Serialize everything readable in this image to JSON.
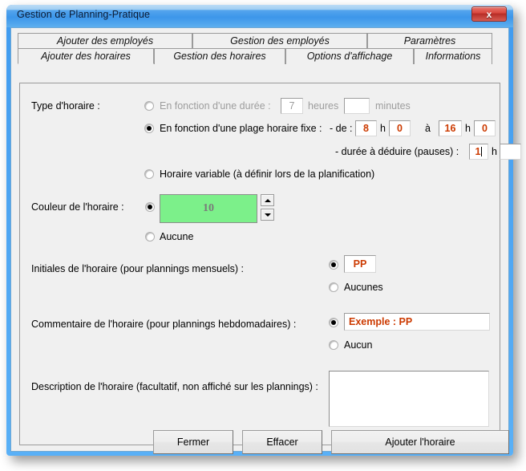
{
  "window": {
    "title": "Gestion de Planning-Pratique",
    "close_glyph": "x"
  },
  "tabs": {
    "row1": [
      {
        "label": "Ajouter des employés",
        "active": false
      },
      {
        "label": "Gestion des employés",
        "active": false
      },
      {
        "label": "Paramètres",
        "active": false
      }
    ],
    "row2": [
      {
        "label": "Ajouter des horaires",
        "active": true
      },
      {
        "label": "Gestion des horaires",
        "active": false
      },
      {
        "label": "Options d'affichage",
        "active": false
      },
      {
        "label": "Informations",
        "active": false
      }
    ]
  },
  "form": {
    "schedule_type_label": "Type d'horaire :",
    "option_duration": {
      "label": "En fonction d'une durée :",
      "selected": false,
      "hours_value": "7",
      "hours_unit": "heures",
      "minutes_value": "",
      "minutes_unit": "minutes"
    },
    "option_fixed_range": {
      "label": "En fonction d'une plage horaire fixe :",
      "selected": true,
      "from_label": "- de :",
      "from_hour": "8",
      "from_h_sep": "h",
      "from_minute": "0",
      "to_label": "à",
      "to_hour": "16",
      "to_h_sep": "h",
      "to_minute": "0",
      "pause_label": "- durée à déduire (pauses) :",
      "pause_hour": "1",
      "pause_h_sep": "h",
      "pause_minute": ""
    },
    "option_variable": {
      "label": "Horaire variable (à définir lors de la planification)",
      "selected": false
    },
    "color": {
      "label": "Couleur de l'horaire :",
      "selected": true,
      "swatch_value": "10",
      "swatch_color": "#7cf08a",
      "spinner_up": "▲",
      "spinner_down": "▼",
      "none_label": "Aucune",
      "none_selected": false
    },
    "initials": {
      "label": "Initiales de l'horaire (pour plannings mensuels) :",
      "selected": true,
      "value": "PP",
      "none_label": "Aucunes",
      "none_selected": false
    },
    "comment": {
      "label": "Commentaire de l'horaire (pour plannings hebdomadaires) :",
      "selected": true,
      "value": "Exemple : PP",
      "none_label": "Aucun",
      "none_selected": false
    },
    "description": {
      "label": "Description de l'horaire (facultatif, non affiché sur les plannings) :",
      "value": ""
    }
  },
  "buttons": {
    "close": "Fermer",
    "clear": "Effacer",
    "add": "Ajouter l'horaire"
  },
  "colors": {
    "accent_value_text": "#cc3a00",
    "titlebar_blue": "#3c96ea",
    "close_red": "#d8453c",
    "swatch_green": "#7cf08a"
  }
}
